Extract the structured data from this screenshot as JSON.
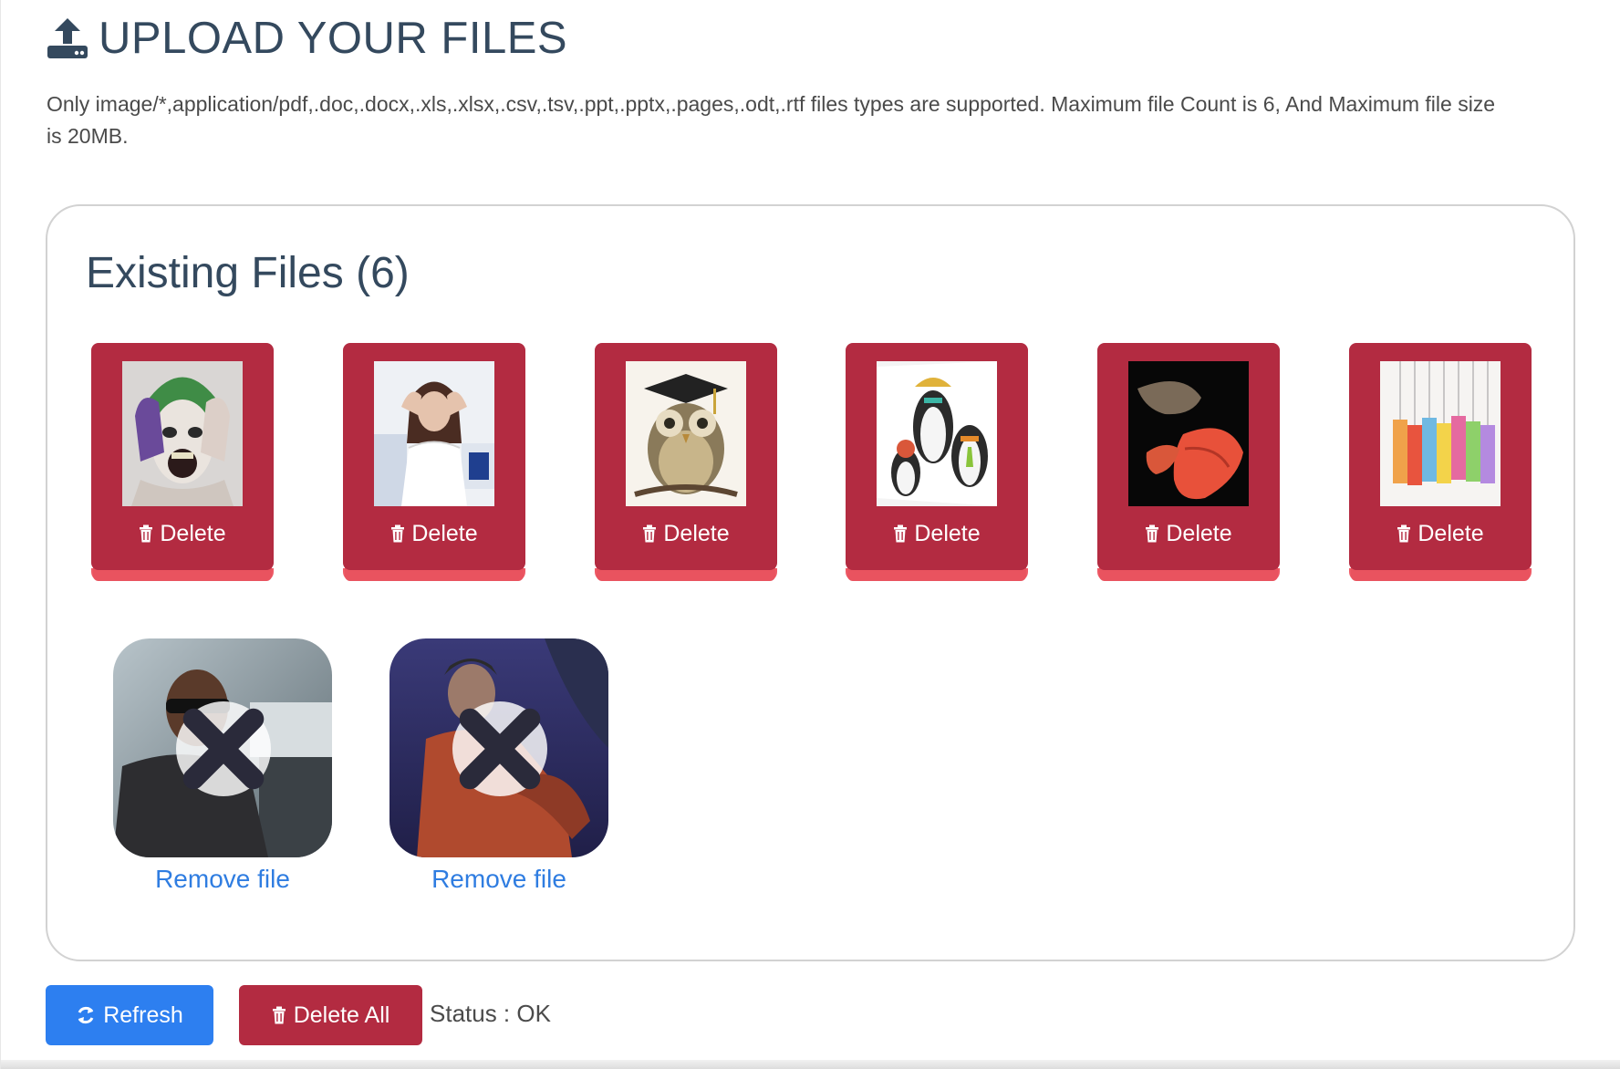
{
  "header": {
    "title": "UPLOAD YOUR FILES",
    "icon": "upload-icon",
    "description": "Only image/*,application/pdf,.doc,.docx,.xls,.xlsx,.csv,.tsv,.ppt,.pptx,.pages,.odt,.rtf files types are supported. Maximum file Count is 6, And Maximum file size is 20MB."
  },
  "panel": {
    "title": "Existing Files (6)"
  },
  "existing_files": [
    {
      "thumb": "joker-photo",
      "delete_label": "Delete"
    },
    {
      "thumb": "woman-stressed-photo",
      "delete_label": "Delete"
    },
    {
      "thumb": "owl-graduate-illustration",
      "delete_label": "Delete"
    },
    {
      "thumb": "penguins-illustration",
      "delete_label": "Delete"
    },
    {
      "thumb": "abstract-lips-image",
      "delete_label": "Delete"
    },
    {
      "thumb": "thank-you-letters-image",
      "delete_label": "Delete"
    }
  ],
  "pending_uploads": [
    {
      "thumb": "man-sunglasses-photo",
      "remove_label": "Remove file"
    },
    {
      "thumb": "game-character-image",
      "remove_label": "Remove file"
    }
  ],
  "footer": {
    "refresh_label": "Refresh",
    "delete_all_label": "Delete All",
    "status_label": "Status : ",
    "status_value": "OK"
  },
  "colors": {
    "title": "#34495e",
    "card_bg": "#b32b41",
    "card_shadow": "#ee5a66",
    "refresh_btn": "#2d7ff0",
    "delete_all_btn": "#b32b41",
    "link": "#2f7de1"
  }
}
